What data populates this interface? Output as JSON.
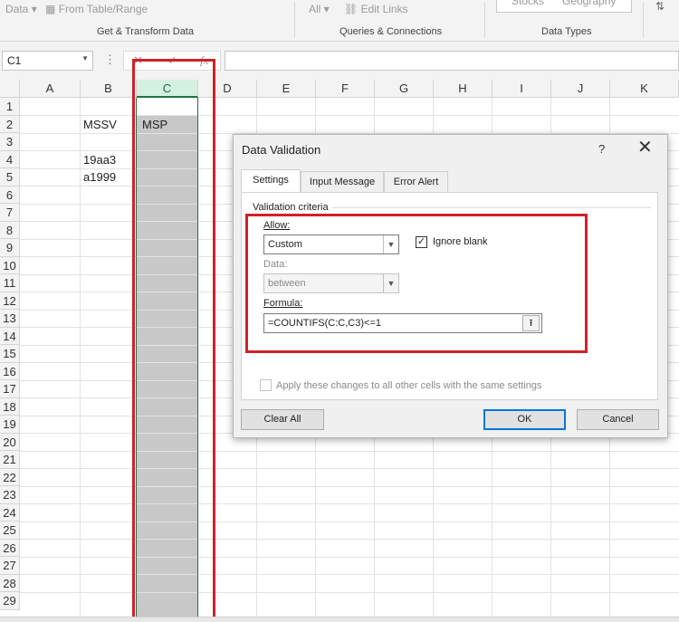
{
  "ribbon": {
    "data_dropdown": "Data",
    "from_table": "From Table/Range",
    "all_dropdown": "All",
    "edit_links": "Edit Links",
    "stocks": "Stocks",
    "geography": "Geography",
    "groups": [
      "Get & Transform Data",
      "Queries & Connections",
      "Data Types"
    ]
  },
  "formula_bar": {
    "name_box": "C1",
    "fx": "fx",
    "value": ""
  },
  "sheet": {
    "columns": [
      "A",
      "B",
      "C",
      "D",
      "E",
      "F",
      "G",
      "H",
      "I",
      "J",
      "K"
    ],
    "rows": [
      "1",
      "2",
      "3",
      "4",
      "5",
      "6",
      "7",
      "8",
      "9",
      "10",
      "11",
      "12",
      "13",
      "14",
      "15",
      "16",
      "17",
      "18",
      "19",
      "20",
      "21",
      "22",
      "23",
      "24",
      "25",
      "26",
      "27",
      "28",
      "29"
    ],
    "cells": {
      "B2": "MSSV",
      "C2": "MSP",
      "B4": "19aa3",
      "B5": "a1999"
    },
    "selected_column": "C",
    "active_cell": "C1"
  },
  "dialog": {
    "title": "Data Validation",
    "help": "?",
    "tabs": [
      "Settings",
      "Input Message",
      "Error Alert"
    ],
    "active_tab": "Settings",
    "criteria_label": "Validation criteria",
    "allow_label": "Allow:",
    "allow_value": "Custom",
    "ignore_blank_label": "Ignore blank",
    "ignore_blank_checked": true,
    "data_label": "Data:",
    "data_value": "between",
    "formula_label": "Formula:",
    "formula_value": "=COUNTIFS(C:C,C3)<=1",
    "apply_label": "Apply these changes to all other cells with the same settings",
    "apply_checked": false,
    "clear_all": "Clear All",
    "ok": "OK",
    "cancel": "Cancel"
  },
  "colors": {
    "highlight_red": "#d0212a",
    "selection_green": "#217346",
    "column_fill": "#c8c8c8"
  }
}
